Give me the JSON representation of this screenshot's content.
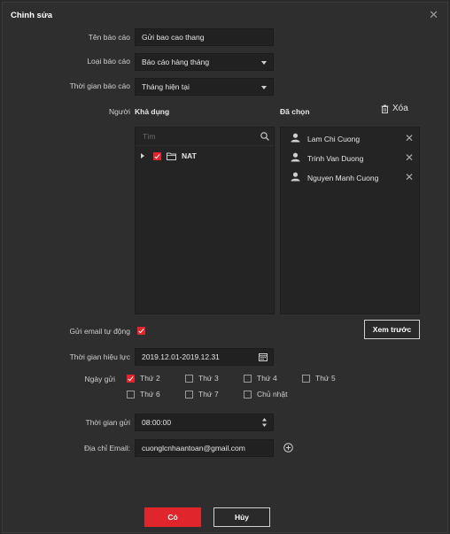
{
  "dialog": {
    "title": "Chỉnh sửa"
  },
  "form": {
    "report_name": {
      "label": "Tên báo cáo",
      "value": "Gửi bao cao thang"
    },
    "report_type": {
      "label": "Loại báo cáo",
      "value": "Báo cáo hàng tháng"
    },
    "report_time": {
      "label": "Thời gian báo cáo",
      "value": "Tháng hiện tại"
    },
    "person": {
      "label": "Người",
      "available_header": "Khả dụng",
      "selected_header": "Đã chọn",
      "clear_label": "Xóa",
      "search_placeholder": "Tìm",
      "tree": [
        {
          "label": "NAT",
          "checked": true
        }
      ],
      "selected": [
        {
          "name": "Lam Chi Cuong"
        },
        {
          "name": "Trinh Van Duong"
        },
        {
          "name": "Nguyen Manh Cuong"
        }
      ]
    },
    "auto_email": {
      "label": "Gửi email tự động",
      "checked": true
    },
    "preview_label": "Xem trước",
    "validity": {
      "label": "Thời gian hiệu lực",
      "value": "2019.12.01-2019.12.31"
    },
    "send_days": {
      "label": "Ngày gửi",
      "days": [
        {
          "label": "Thứ 2",
          "checked": true
        },
        {
          "label": "Thứ 3",
          "checked": false
        },
        {
          "label": "Thứ 4",
          "checked": false
        },
        {
          "label": "Thứ 5",
          "checked": false
        },
        {
          "label": "Thứ 6",
          "checked": false
        },
        {
          "label": "Thứ 7",
          "checked": false
        },
        {
          "label": "Chủ nhật",
          "checked": false
        }
      ]
    },
    "send_time": {
      "label": "Thời gian gửi",
      "value": "08:00:00"
    },
    "email": {
      "label": "Địa chỉ Email:",
      "value": "cuonglcnhaantoan@gmail.com"
    }
  },
  "footer": {
    "ok_label": "Có",
    "cancel_label": "Hủy"
  },
  "colors": {
    "accent": "#e0262c",
    "background": "#2e2e2e",
    "field": "#212121"
  }
}
